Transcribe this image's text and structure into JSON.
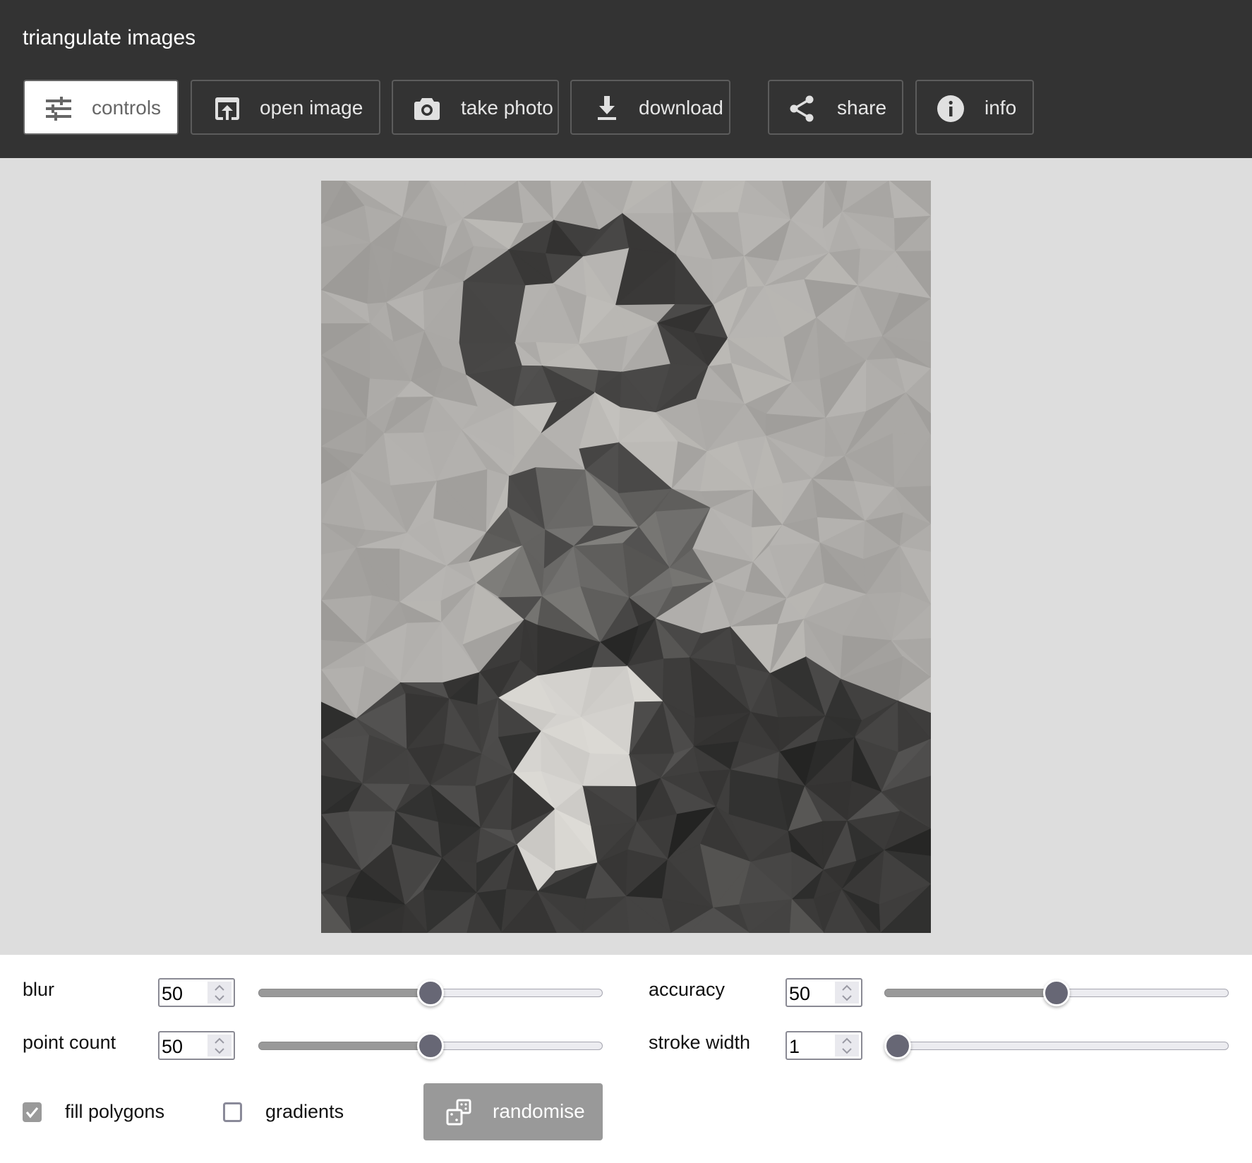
{
  "app": {
    "title": "triangulate images"
  },
  "toolbar": {
    "buttons": [
      {
        "id": "controls",
        "label": "controls",
        "icon": "sliders-icon",
        "active": true
      },
      {
        "id": "open-image",
        "label": "open image",
        "icon": "upload-icon",
        "active": false
      },
      {
        "id": "take-photo",
        "label": "take photo",
        "icon": "camera-icon",
        "active": false
      },
      {
        "id": "download",
        "label": "download",
        "icon": "download-icon",
        "active": false
      },
      {
        "id": "share",
        "label": "share",
        "icon": "share-icon",
        "active": false
      },
      {
        "id": "info",
        "label": "info",
        "icon": "info-icon",
        "active": false
      }
    ]
  },
  "canvas": {
    "description": "low-poly triangulated grayscale portrait of a bearded man"
  },
  "controls": {
    "blur": {
      "label": "blur",
      "value": "50",
      "fraction": 0.5
    },
    "accuracy": {
      "label": "accuracy",
      "value": "50",
      "fraction": 0.5
    },
    "point_count": {
      "label": "point count",
      "value": "50",
      "fraction": 0.5
    },
    "stroke_width": {
      "label": "stroke width",
      "value": "1",
      "fraction": 0.0
    },
    "fill_polygons": {
      "label": "fill polygons",
      "checked": true
    },
    "gradients": {
      "label": "gradients",
      "checked": false
    },
    "randomise": {
      "label": "randomise",
      "icon": "dice-icon"
    }
  },
  "colors": {
    "header_bg": "#333333",
    "stage_bg": "#dddddd",
    "slider_thumb": "#676775",
    "slider_fill": "#999999",
    "button_disabled": "#999999"
  }
}
